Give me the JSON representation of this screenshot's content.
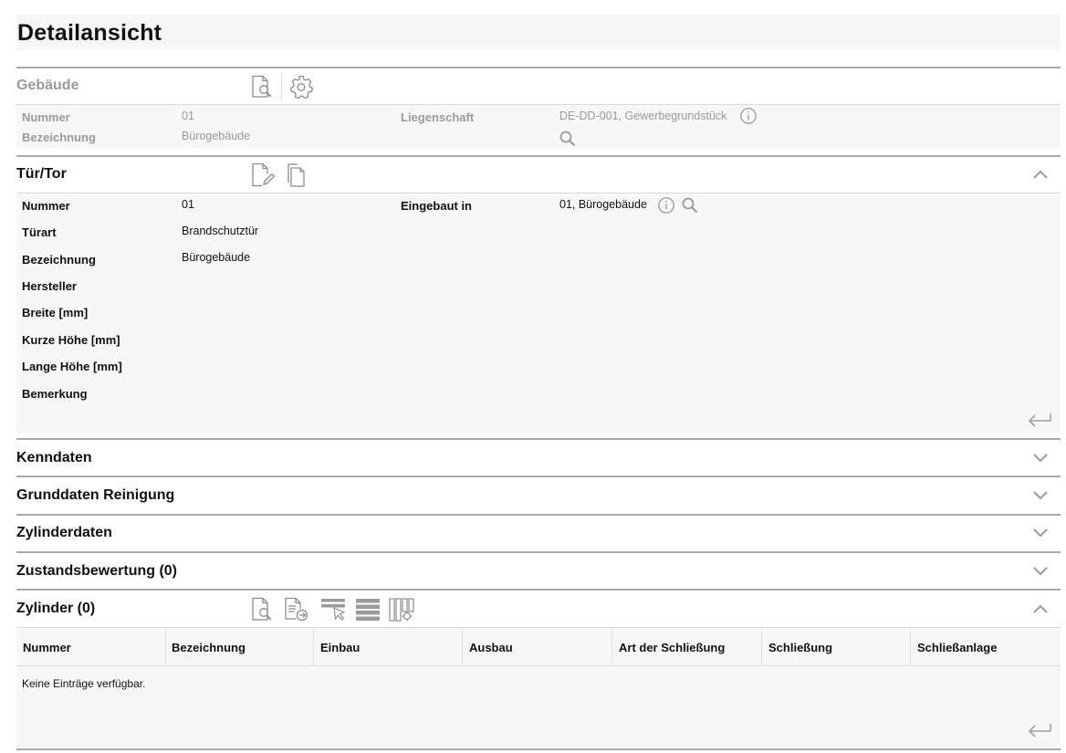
{
  "page": {
    "title": "Detailansicht"
  },
  "gebaeude": {
    "title": "Gebäude",
    "fields": {
      "nummer_label": "Nummer",
      "nummer_value": "01",
      "bezeichnung_label": "Bezeichnung",
      "bezeichnung_value": "Bürogebäude",
      "liegenschaft_label": "Liegenschaft",
      "liegenschaft_value": "DE-DD-001, Gewerbegrundstück"
    }
  },
  "tuer": {
    "title": "Tür/Tor",
    "fields": {
      "nummer_label": "Nummer",
      "nummer_value": "01",
      "tuerart_label": "Türart",
      "tuerart_value": "Brandschutztür",
      "bezeichnung_label": "Bezeichnung",
      "bezeichnung_value": "Bürogebäude",
      "hersteller_label": "Hersteller",
      "breite_label": "Breite [mm]",
      "kurze_hoehe_label": "Kurze Höhe [mm]",
      "lange_hoehe_label": "Lange Höhe [mm]",
      "bemerkung_label": "Bemerkung",
      "eingebaut_label": "Eingebaut in",
      "eingebaut_value": "01, Bürogebäude"
    }
  },
  "sections": {
    "kenndaten": "Kenndaten",
    "grunddaten": "Grunddaten Reinigung",
    "zylinderdaten": "Zylinderdaten",
    "zustand": "Zustandsbewertung (0)"
  },
  "zylinder": {
    "title": "Zylinder (0)",
    "columns": [
      "Nummer",
      "Bezeichnung",
      "Einbau",
      "Ausbau",
      "Art der Schließung",
      "Schließung",
      "Schließanlage"
    ],
    "empty_text": "Keine Einträge verfügbar."
  },
  "colors": {
    "rule": "#a9a9a9",
    "panel": "#f7f7f7",
    "muted": "#9a9a9a",
    "icon": "#8c8c8c"
  }
}
